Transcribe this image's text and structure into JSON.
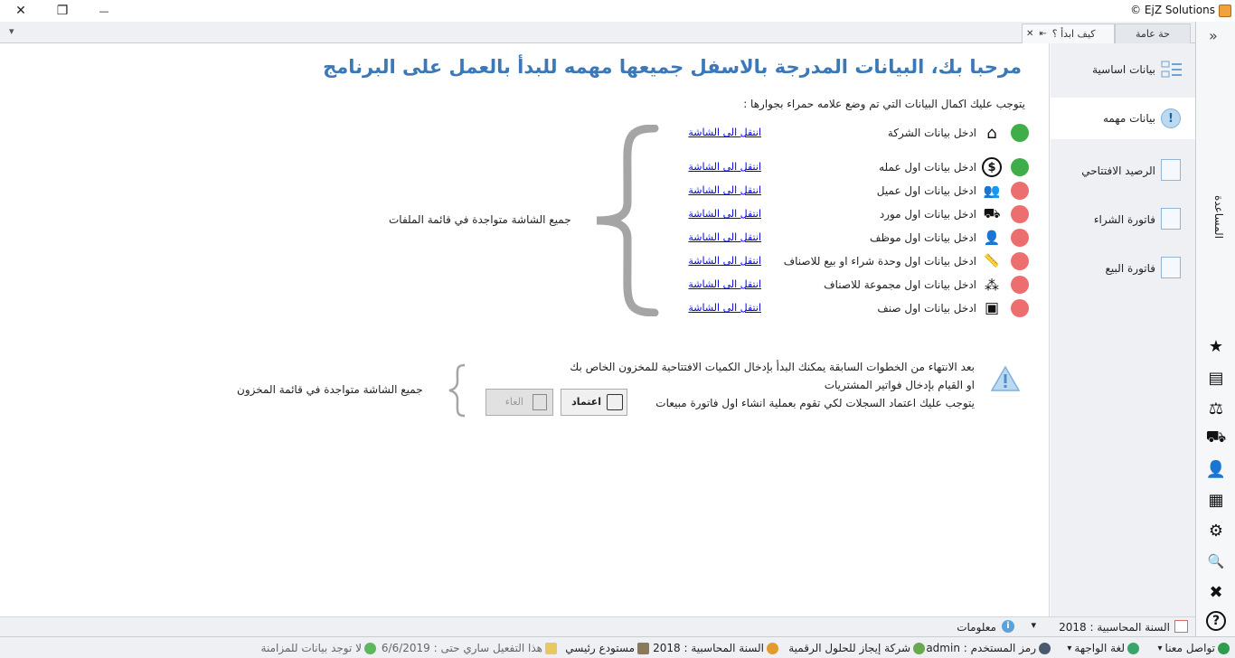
{
  "window": {
    "title": "© EjZ Solutions",
    "close_glyph": "✕",
    "restore_glyph": "❐",
    "minimize_glyph": "—"
  },
  "tabs": {
    "menu_glyph": "▾",
    "items": [
      {
        "label": "حة عامة"
      },
      {
        "label": "كيف ابدأ ؟"
      }
    ],
    "pin_glyph": "⇤",
    "close_glyph": "✕",
    "collapse_glyph": "»"
  },
  "main": {
    "title": "مرحبا بك، البيانات المدرجة بالاسفل جميعها مهمه للبدأ بالعمل على البرنامج",
    "intro": "يتوجب عليك اكمال البيانات التي تم وضع علامه حمراء بجوارها :",
    "steps": [
      {
        "label": "ادخل بيانات الشركة",
        "link": "انتقل الى الشاشة",
        "status": "ok",
        "icon": "home-icon",
        "glyph": "⌂"
      },
      {
        "label": "ادخل بيانات اول عمله",
        "link": "انتقل الى الشاشة",
        "status": "ok",
        "icon": "dollar-icon",
        "glyph": "$"
      },
      {
        "label": "ادخل بيانات اول عميل",
        "link": "انتقل الى الشاشة",
        "status": "missing",
        "icon": "customers-icon",
        "glyph": "👥"
      },
      {
        "label": "ادخل بيانات اول مورد",
        "link": "انتقل الى الشاشة",
        "status": "missing",
        "icon": "supplier-icon",
        "glyph": "⛟"
      },
      {
        "label": "ادخل بيانات اول موظف",
        "link": "انتقل الى الشاشة",
        "status": "missing",
        "icon": "employee-icon",
        "glyph": "👤"
      },
      {
        "label": "ادخل بيانات اول وحدة شراء او بيع للاصناف",
        "link": "انتقل الى الشاشة",
        "status": "missing",
        "icon": "ruler-icon",
        "glyph": "📏"
      },
      {
        "label": "ادخل بيانات اول مجموعة للاصناف",
        "link": "انتقل الى الشاشة",
        "status": "missing",
        "icon": "group-icon",
        "glyph": "⁂"
      },
      {
        "label": "ادخل بيانات اول صنف",
        "link": "انتقل الى الشاشة",
        "status": "missing",
        "icon": "item-box-icon",
        "glyph": "▣"
      }
    ],
    "files_note": "جميع الشاشة متواجدة في قائمة الملفات",
    "final_lines": [
      "بعد الانتهاء من الخطوات السابقة يمكنك البدأ بإدخال الكميات الافتتاحية للمخزون الخاص بك",
      "او القيام بإدخال فواتير المشتريات",
      "يتوجب عليك اعتماد السجلات لكي تقوم بعملية انشاء اول فاتورة مبيعات"
    ],
    "inventory_note": "جميع الشاشة متواجدة في قائمة المخزون",
    "approve_label": "اعتماد",
    "cancel_label": "الغاء"
  },
  "sidebar": {
    "items": [
      {
        "label": "بيانات اساسية",
        "active": false
      },
      {
        "label": "بيانات مهمه",
        "active": true
      },
      {
        "label": "الرصيد الافتتاحي",
        "active": false
      },
      {
        "label": "فاتورة الشراء",
        "active": false
      },
      {
        "label": "فاتورة البيع",
        "active": false
      }
    ]
  },
  "rail": {
    "help_label": "المساعدة",
    "icons": [
      {
        "name": "favorites-star-icon",
        "glyph": "★"
      },
      {
        "name": "inventory-icon",
        "glyph": "▤"
      },
      {
        "name": "accounting-scale-icon",
        "glyph": "⚖"
      },
      {
        "name": "supplier-icon",
        "glyph": "⛟"
      },
      {
        "name": "employee-icon",
        "glyph": "👤"
      },
      {
        "name": "cash-register-icon",
        "glyph": "▦"
      },
      {
        "name": "settings-gear-icon",
        "glyph": "⚙"
      },
      {
        "name": "reports-search-icon",
        "glyph": "🔍"
      },
      {
        "name": "tools-icon",
        "glyph": "✖"
      },
      {
        "name": "help-question-icon",
        "glyph": "?"
      }
    ]
  },
  "info_bar": {
    "fiscal_year": "السنة المحاسبية : 2018",
    "info_label": "معلومات"
  },
  "status_bar": {
    "contact": "تواصل معنا",
    "language": "لغة الواجهة",
    "user": "رمز المستخدم : admin",
    "company": "شركة إيجاز للحلول الرقمية",
    "fiscal_year": "السنة المحاسبية : 2018",
    "warehouse": "مستودع رئيسي",
    "activation": "هذا التفعيل ساري حتى : 6/6/2019",
    "sync": "لا توجد بيانات للمزامنة",
    "colors": {
      "accent": "#3b78b8",
      "ok": "#3fae49",
      "missing": "#ec6e6e"
    }
  }
}
